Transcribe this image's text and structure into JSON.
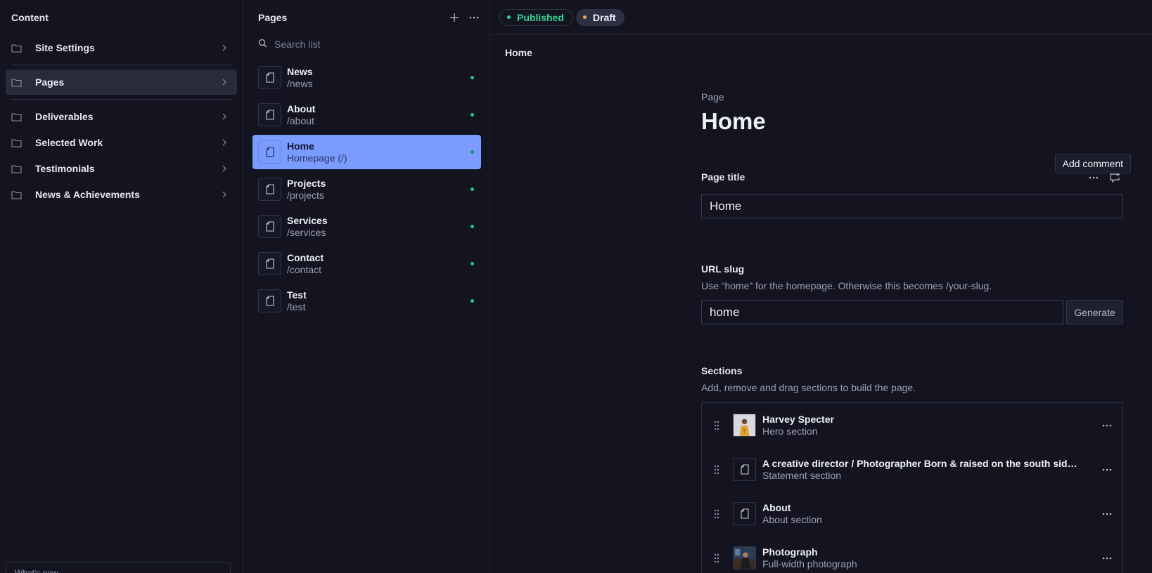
{
  "content": {
    "title": "Content",
    "items": [
      {
        "label": "Site Settings"
      },
      {
        "label": "Pages"
      },
      {
        "label": "Deliverables"
      },
      {
        "label": "Selected Work"
      },
      {
        "label": "Testimonials"
      },
      {
        "label": "News & Achievements"
      }
    ],
    "whats_new": "What's new"
  },
  "pages": {
    "title": "Pages",
    "search_placeholder": "Search list",
    "items": [
      {
        "name": "News",
        "path": "/news"
      },
      {
        "name": "About",
        "path": "/about"
      },
      {
        "name": "Home",
        "path": "Homepage (/)"
      },
      {
        "name": "Projects",
        "path": "/projects"
      },
      {
        "name": "Services",
        "path": "/services"
      },
      {
        "name": "Contact",
        "path": "/contact"
      },
      {
        "name": "Test",
        "path": "/test"
      }
    ]
  },
  "document": {
    "status": {
      "published": "Published",
      "draft": "Draft"
    },
    "breadcrumb": "Home",
    "kind": "Page",
    "title": "Home",
    "tooltip": "Add comment",
    "page_title": {
      "label": "Page title",
      "value": "Home"
    },
    "slug": {
      "label": "URL slug",
      "help": "Use “home” for the homepage. Otherwise this becomes /your-slug.",
      "value": "home",
      "generate": "Generate"
    },
    "sections": {
      "label": "Sections",
      "help": "Add, remove and drag sections to build the page.",
      "items": [
        {
          "title": "Harvey Specter",
          "subtitle": "Hero section"
        },
        {
          "title": "A creative director / Photographer Born & raised on the south side of c...",
          "subtitle": "Statement section"
        },
        {
          "title": "About",
          "subtitle": "About section"
        },
        {
          "title": "Photograph",
          "subtitle": "Full-width photograph"
        }
      ]
    }
  },
  "colors": {
    "accent": "#7a9cff",
    "published": "#2fd39a",
    "draft": "#f2a44a",
    "background": "#13141f"
  }
}
